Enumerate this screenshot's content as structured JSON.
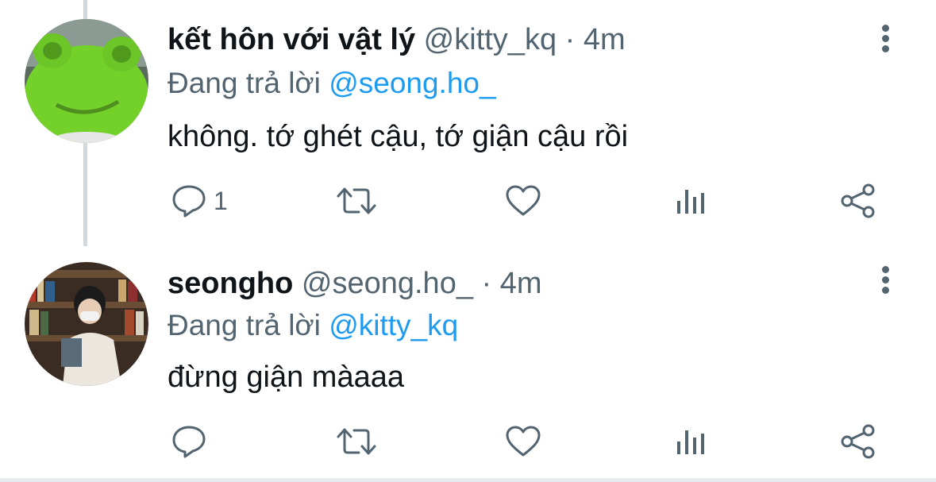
{
  "colors": {
    "accent": "#1d9bf0",
    "muted": "#536471",
    "text": "#0f1419",
    "thread_line": "#cfd9de"
  },
  "tweets": [
    {
      "name": "kết hôn với vật lý",
      "handle": "@kitty_kq",
      "separator": "·",
      "time": "4m",
      "reply_prefix": "Đang trả lời",
      "reply_to": "@seong.ho_",
      "text": "không. tớ ghét cậu, tớ giận cậu rồi",
      "reply_count": "1",
      "avatar": "green-frog-plush-avatar"
    },
    {
      "name": "seongho",
      "handle": "@seong.ho_",
      "separator": "·",
      "time": "4m",
      "reply_prefix": "Đang trả lời",
      "reply_to": "@kitty_kq",
      "text": "đừng giận màaaa",
      "reply_count": "",
      "avatar": "person-in-library-avatar"
    }
  ],
  "icons": [
    "reply-icon",
    "retweet-icon",
    "like-icon",
    "views-icon",
    "share-icon",
    "more-options-icon"
  ]
}
